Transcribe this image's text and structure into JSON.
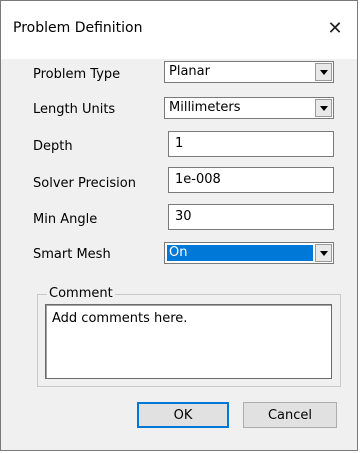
{
  "window": {
    "title": "Problem Definition",
    "close_glyph": "✕"
  },
  "fields": {
    "problem_type": {
      "label": "Problem Type",
      "value": "Planar"
    },
    "length_units": {
      "label": "Length Units",
      "value": "Millimeters"
    },
    "depth": {
      "label": "Depth",
      "value": "1"
    },
    "solver_precision": {
      "label": "Solver Precision",
      "value": "1e-008"
    },
    "min_angle": {
      "label": "Min Angle",
      "value": "30"
    },
    "smart_mesh": {
      "label": "Smart Mesh",
      "value": "On"
    }
  },
  "comment": {
    "legend": "Comment",
    "value": "Add comments here."
  },
  "buttons": {
    "ok": "OK",
    "cancel": "Cancel"
  },
  "colors": {
    "selection": "#0078d7",
    "dialog_bg": "#f0f0f0"
  }
}
